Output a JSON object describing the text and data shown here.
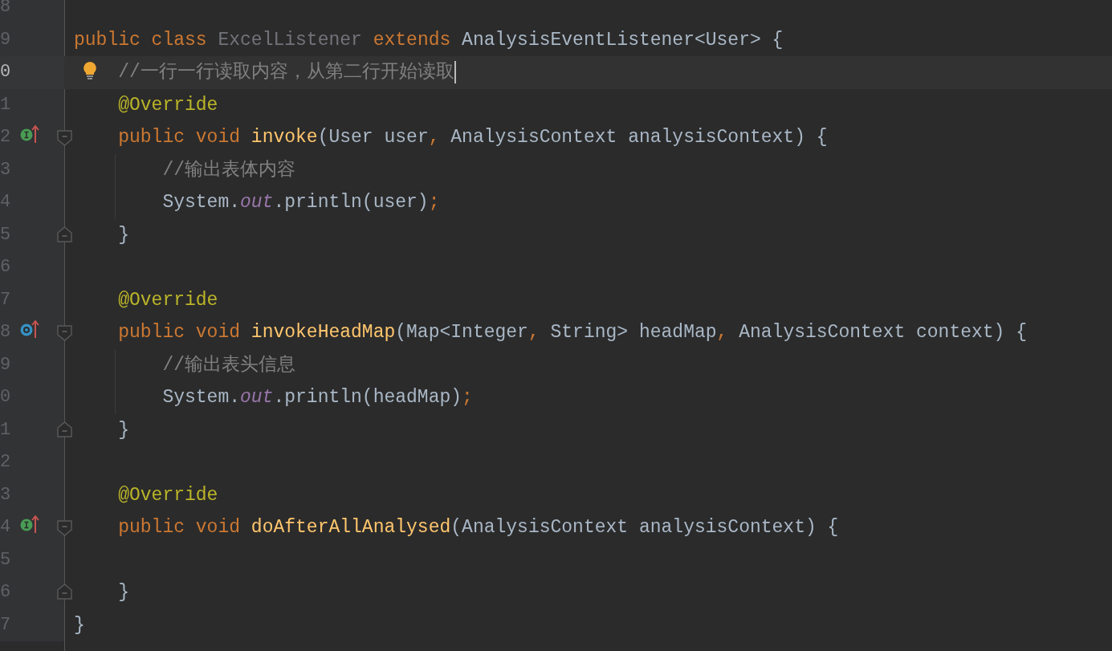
{
  "editor": {
    "lines": [
      {
        "number": "8",
        "current": false,
        "guide": false
      },
      {
        "number": "9",
        "current": false,
        "guide": false,
        "tokens": [
          {
            "text": "public class ",
            "kind": "keyword"
          },
          {
            "text": "ExcelListener ",
            "kind": "unused"
          },
          {
            "text": "extends ",
            "kind": "keyword"
          },
          {
            "text": "AnalysisEventListener<User> {",
            "kind": "plain"
          }
        ]
      },
      {
        "number": "0",
        "current": true,
        "caret": true,
        "bulb": true,
        "guide": false,
        "indent": {
          "kind": "member"
        },
        "tokens": [
          {
            "text": "//一行一行读取内容，从第二行开始读取",
            "kind": "comment"
          }
        ]
      },
      {
        "number": "1",
        "current": false,
        "guide": false,
        "indent": {
          "kind": "member"
        },
        "tokens": [
          {
            "text": "@Override",
            "kind": "annotation"
          }
        ]
      },
      {
        "number": "2",
        "current": false,
        "guide": false,
        "marker": {
          "kind": "implements"
        },
        "fold": {
          "kind": "start"
        },
        "indent": {
          "kind": "member"
        },
        "tokens": [
          {
            "text": "public void ",
            "kind": "keyword"
          },
          {
            "text": "invoke",
            "kind": "method"
          },
          {
            "text": "(User user",
            "kind": "plain"
          },
          {
            "text": ", ",
            "kind": "keyword"
          },
          {
            "text": "AnalysisContext analysisContext) {",
            "kind": "plain"
          }
        ]
      },
      {
        "number": "3",
        "current": false,
        "guide": true,
        "indent": {
          "kind": "body"
        },
        "tokens": [
          {
            "text": "//输出表体内容",
            "kind": "comment"
          }
        ]
      },
      {
        "number": "4",
        "current": false,
        "guide": true,
        "indent": {
          "kind": "body"
        },
        "tokens": [
          {
            "text": "System.",
            "kind": "plain"
          },
          {
            "text": "out",
            "kind": "static"
          },
          {
            "text": ".println(user)",
            "kind": "plain"
          },
          {
            "text": ";",
            "kind": "keyword"
          }
        ]
      },
      {
        "number": "5",
        "current": false,
        "guide": false,
        "fold": {
          "kind": "end"
        },
        "indent": {
          "kind": "member"
        },
        "tokens": [
          {
            "text": "}",
            "kind": "plain"
          }
        ]
      },
      {
        "number": "6",
        "current": false,
        "guide": false
      },
      {
        "number": "7",
        "current": false,
        "guide": false,
        "indent": {
          "kind": "member"
        },
        "tokens": [
          {
            "text": "@Override",
            "kind": "annotation"
          }
        ]
      },
      {
        "number": "8",
        "current": false,
        "guide": false,
        "marker": {
          "kind": "overrides"
        },
        "fold": {
          "kind": "start"
        },
        "indent": {
          "kind": "member"
        },
        "tokens": [
          {
            "text": "public void ",
            "kind": "keyword"
          },
          {
            "text": "invokeHeadMap",
            "kind": "method"
          },
          {
            "text": "(Map<Integer",
            "kind": "plain"
          },
          {
            "text": ", ",
            "kind": "keyword"
          },
          {
            "text": "String> headMap",
            "kind": "plain"
          },
          {
            "text": ", ",
            "kind": "keyword"
          },
          {
            "text": "AnalysisContext context) {",
            "kind": "plain"
          }
        ]
      },
      {
        "number": "9",
        "current": false,
        "guide": true,
        "indent": {
          "kind": "body"
        },
        "tokens": [
          {
            "text": "//输出表头信息",
            "kind": "comment"
          }
        ]
      },
      {
        "number": "0",
        "current": false,
        "guide": true,
        "indent": {
          "kind": "body"
        },
        "tokens": [
          {
            "text": "System.",
            "kind": "plain"
          },
          {
            "text": "out",
            "kind": "static"
          },
          {
            "text": ".println(headMap)",
            "kind": "plain"
          },
          {
            "text": ";",
            "kind": "keyword"
          }
        ]
      },
      {
        "number": "1",
        "current": false,
        "guide": false,
        "fold": {
          "kind": "end"
        },
        "indent": {
          "kind": "member"
        },
        "tokens": [
          {
            "text": "}",
            "kind": "plain"
          }
        ]
      },
      {
        "number": "2",
        "current": false,
        "guide": false
      },
      {
        "number": "3",
        "current": false,
        "guide": false,
        "indent": {
          "kind": "member"
        },
        "tokens": [
          {
            "text": "@Override",
            "kind": "annotation"
          }
        ]
      },
      {
        "number": "4",
        "current": false,
        "guide": false,
        "marker": {
          "kind": "implements"
        },
        "fold": {
          "kind": "start"
        },
        "indent": {
          "kind": "member"
        },
        "tokens": [
          {
            "text": "public void ",
            "kind": "keyword"
          },
          {
            "text": "doAfterAllAnalysed",
            "kind": "method"
          },
          {
            "text": "(AnalysisContext analysisContext) {",
            "kind": "plain"
          }
        ]
      },
      {
        "number": "5",
        "current": false,
        "guide": false
      },
      {
        "number": "6",
        "current": false,
        "guide": false,
        "fold": {
          "kind": "end"
        },
        "indent": {
          "kind": "member"
        },
        "tokens": [
          {
            "text": "}",
            "kind": "plain"
          }
        ]
      },
      {
        "number": "7",
        "current": false,
        "guide": false,
        "tokens": [
          {
            "text": "}",
            "kind": "plain"
          }
        ]
      }
    ]
  }
}
